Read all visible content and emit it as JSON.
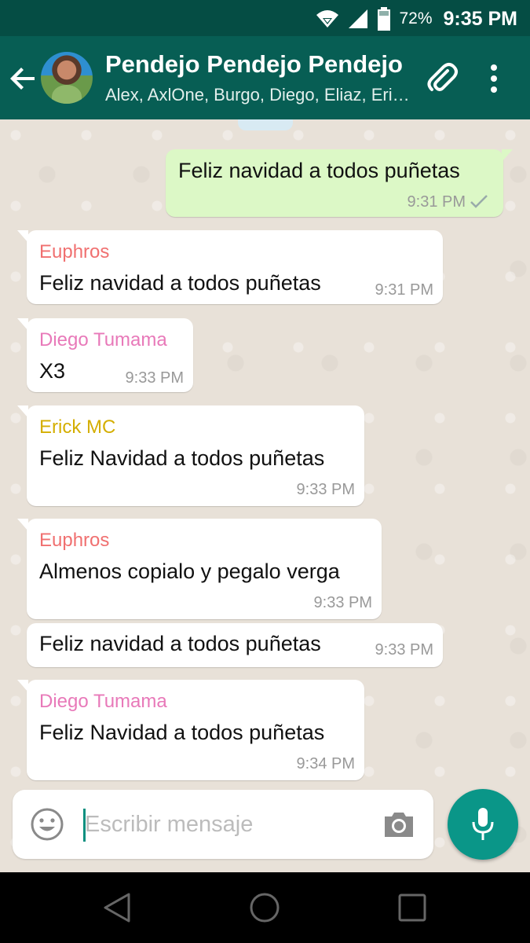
{
  "status_bar": {
    "battery": "72%",
    "time": "9:35 PM"
  },
  "header": {
    "title": "Pendejo Pendejo Pendejo",
    "subtitle": "Alex, AxlOne, Burgo, Diego, Eliaz, Erick MC"
  },
  "colors": {
    "header": "#075e54",
    "status_bar": "#054d44",
    "outgoing_bubble": "#dcf8c6",
    "accent": "#0a9688",
    "sender_euphros": "#f07070",
    "sender_diego": "#e879b9",
    "sender_erick": "#d4ae00"
  },
  "messages": [
    {
      "direction": "out",
      "text": "Feliz navidad a todos puñetas",
      "time": "9:31 PM",
      "status": "sent-tick"
    },
    {
      "direction": "in",
      "sender": "Euphros",
      "text": "Feliz navidad a todos puñetas",
      "time": "9:31 PM"
    },
    {
      "direction": "in",
      "sender": "Diego Tumama",
      "text": "X3",
      "time": "9:33 PM"
    },
    {
      "direction": "in",
      "sender": "Erick MC",
      "text": "Feliz Navidad a todos puñetas",
      "time": "9:33 PM"
    },
    {
      "direction": "in",
      "sender": "Euphros",
      "text": "Almenos copialo y pegalo verga",
      "time": "9:33 PM"
    },
    {
      "direction": "in",
      "text": "Feliz navidad a todos puñetas",
      "time": "9:33 PM"
    },
    {
      "direction": "in",
      "sender": "Diego Tumama",
      "text": "Feliz Navidad a todos puñetas",
      "time": "9:34 PM"
    }
  ],
  "composer": {
    "placeholder": "Escribir mensaje"
  },
  "icons": {
    "header": [
      "back-arrow-icon",
      "avatar",
      "paperclip-icon",
      "more-vert-icon"
    ],
    "status": [
      "wifi-icon",
      "signal-icon",
      "battery-icon"
    ],
    "composer": [
      "emoji-icon",
      "camera-icon",
      "mic-icon"
    ],
    "nav": [
      "nav-back-icon",
      "nav-home-icon",
      "nav-recents-icon"
    ]
  }
}
